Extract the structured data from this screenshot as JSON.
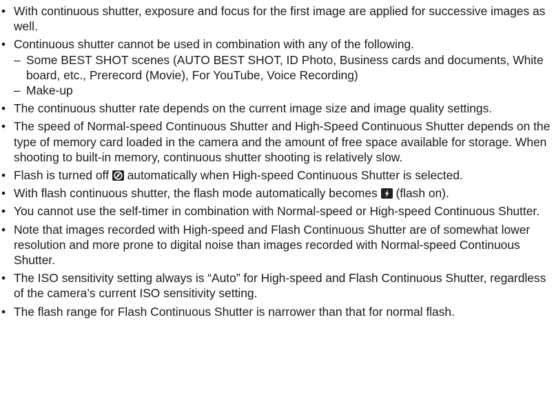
{
  "bullet": "•",
  "dash": "–",
  "notes": [
    {
      "text": "With continuous shutter, exposure and focus for the first image are applied for successive images as well."
    },
    {
      "text": "Continuous shutter cannot be used in combination with any of the following."
    },
    {
      "text": "The continuous shutter rate depends on the current image size and image quality settings."
    },
    {
      "text": "The speed of Normal-speed Continuous Shutter and High-Speed Continuous Shutter depends on the type of memory card loaded in the camera and the amount of free space available for storage. When shooting to built-in memory, continuous shutter shooting is relatively slow."
    },
    {
      "text_before": "Flash is turned off",
      "text_after": "automatically when High-speed Continuous Shutter is selected.",
      "icon": "flash-off-icon"
    },
    {
      "text_before": "With flash continuous shutter, the flash mode automatically becomes",
      "text_after": "(flash on).",
      "icon": "flash-on-icon"
    },
    {
      "text": "You cannot use the self-timer in combination with Normal-speed or High-speed Continuous Shutter."
    },
    {
      "text": "Note that images recorded with High-speed and Flash Continuous Shutter are of somewhat lower resolution and more prone to digital noise than images recorded with Normal-speed Continuous Shutter."
    },
    {
      "text": "The ISO sensitivity setting always is “Auto” for High-speed and Flash Continuous Shutter, regardless of the camera’s current ISO sensitivity setting."
    },
    {
      "text": "The flash range for Flash Continuous Shutter is narrower than that for normal flash."
    }
  ],
  "subitems": [
    "Some BEST SHOT scenes (AUTO BEST SHOT, ID Photo, Business cards and documents, White board, etc., Prerecord (Movie), For YouTube, Voice Recording)",
    "Make-up"
  ]
}
